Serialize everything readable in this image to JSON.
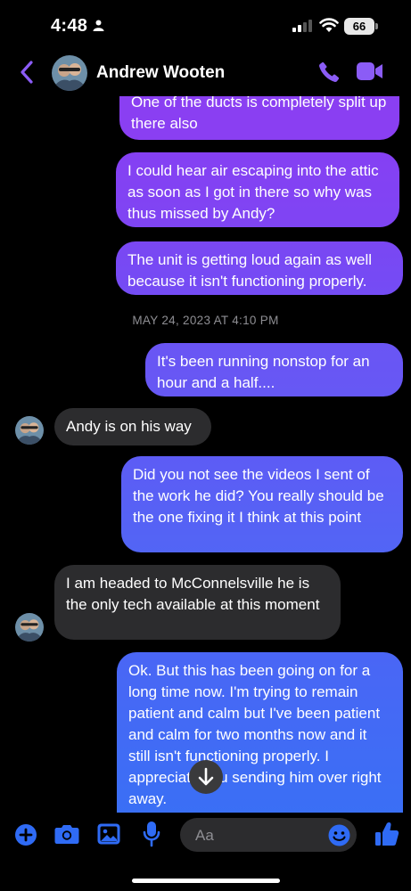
{
  "status_bar": {
    "time": "4:48",
    "battery": "66"
  },
  "header": {
    "contact_name": "Andrew Wooten"
  },
  "messages": [
    {
      "dir": "out",
      "text": "One of the ducts is completely split up there also"
    },
    {
      "dir": "out",
      "text": "I could hear air escaping into the attic as soon as I got in there so why was thus missed by Andy?"
    },
    {
      "dir": "out",
      "text": "The unit is getting loud again as well because it isn't functioning properly."
    },
    {
      "dir": "out",
      "text": "It's been running nonstop for an hour and a half...."
    },
    {
      "dir": "in",
      "text": "Andy is on his way"
    },
    {
      "dir": "out",
      "text": "Did you not see the videos I sent of the work he did? You really should be the one fixing it I think at this point"
    },
    {
      "dir": "in",
      "text": "I am headed to McConnelsville he is the only tech available at this moment"
    },
    {
      "dir": "out",
      "text": "Ok. But this has been going on for a long time now. I'm trying to remain patient and calm but I've been patient and calm for two months now and it still isn't functioning properly. I appreciate you sending him over right away."
    }
  ],
  "timestamp": "MAY 24, 2023 AT 4:10 PM",
  "composer": {
    "placeholder": "Aa"
  },
  "colors": {
    "accent": "#8b5cf6",
    "bubble_top": "#8b3df0",
    "bubble_bottom": "#2f6bf5",
    "incoming": "#2c2c2e"
  }
}
